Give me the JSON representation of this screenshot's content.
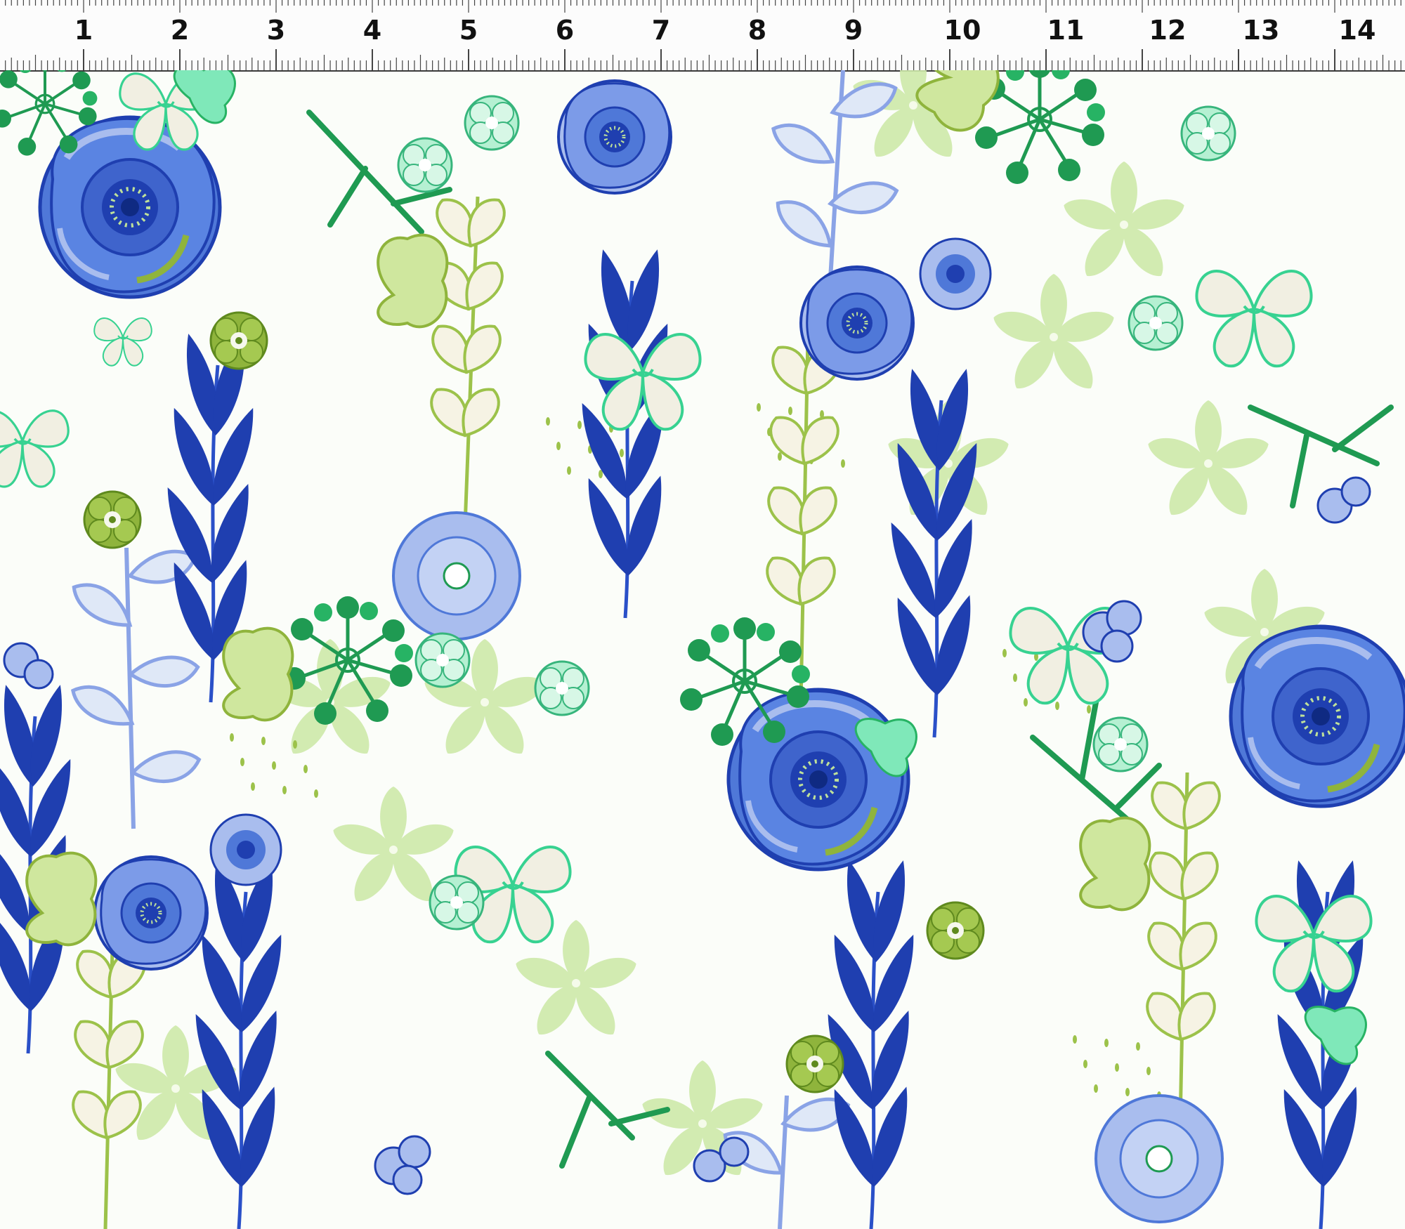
{
  "ruler": {
    "unit": "inch",
    "labels": [
      "1",
      "2",
      "3",
      "4",
      "5",
      "6",
      "7",
      "8",
      "9",
      "10",
      "11",
      "12",
      "13",
      "14"
    ]
  },
  "fabric": {
    "description": "floral fabric print",
    "colors": {
      "background": "#fbfdf9",
      "royal_blue": "#1f3fb0",
      "cornflower": "#4f78d8",
      "periwinkle": "#a9bdee",
      "emerald": "#1f9a52",
      "mint": "#7fe8b9",
      "lime": "#bfe19a",
      "olive": "#8fb43c",
      "cream": "#f1efe2"
    },
    "motifs": [
      "rose-icon",
      "leaf-spray-icon",
      "orchid-icon",
      "succulent-icon",
      "berry-cluster-icon",
      "eucalyptus-icon",
      "seed-dots-icon"
    ]
  }
}
